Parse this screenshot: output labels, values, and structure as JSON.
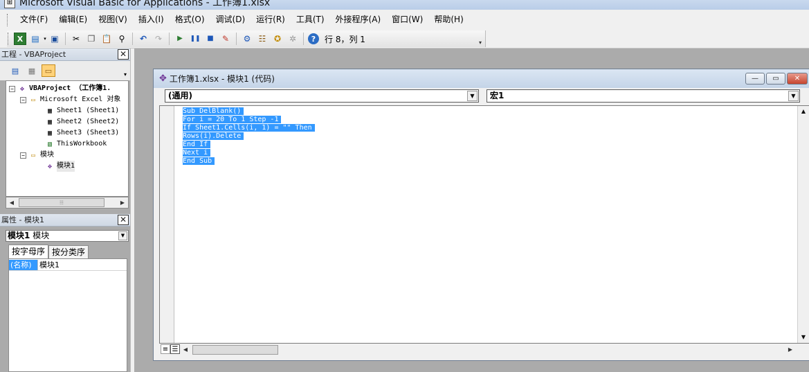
{
  "app": {
    "title": "Microsoft Visual Basic for Applications - 工作簿1.xlsx",
    "icon": "vba-app-icon"
  },
  "menu": [
    "文件(F)",
    "编辑(E)",
    "视图(V)",
    "插入(I)",
    "格式(O)",
    "调试(D)",
    "运行(R)",
    "工具(T)",
    "外接程序(A)",
    "窗口(W)",
    "帮助(H)"
  ],
  "toolbar": {
    "icons": [
      "excel-icon",
      "insert-module-icon",
      "save-icon",
      "cut-icon",
      "copy-icon",
      "paste-icon",
      "find-icon",
      "undo-icon",
      "redo-icon",
      "run-icon",
      "break-icon",
      "reset-icon",
      "design-mode-icon",
      "project-explorer-icon",
      "properties-icon",
      "object-browser-icon",
      "toolbox-icon",
      "help-icon"
    ],
    "position": "行 8，列 1"
  },
  "project": {
    "title": "工程 - VBAProject",
    "tree": [
      {
        "label": "VBAProject （工作簿1.",
        "level": 0,
        "toggle": "−",
        "icon": "vba-project-icon",
        "bold": true
      },
      {
        "label": "Microsoft Excel 对象",
        "level": 1,
        "toggle": "−",
        "icon": "folder-icon"
      },
      {
        "label": "Sheet1 (Sheet1)",
        "level": 2,
        "icon": "worksheet-icon"
      },
      {
        "label": "Sheet2 (Sheet2)",
        "level": 2,
        "icon": "worksheet-icon"
      },
      {
        "label": "Sheet3 (Sheet3)",
        "level": 2,
        "icon": "worksheet-icon"
      },
      {
        "label": "ThisWorkbook",
        "level": 2,
        "icon": "workbook-icon"
      },
      {
        "label": "模块",
        "level": 1,
        "toggle": "−",
        "icon": "folder-icon"
      },
      {
        "label": "模块1",
        "level": 2,
        "icon": "module-icon",
        "selected": true
      }
    ]
  },
  "properties": {
    "title": "属性 - 模块1",
    "object_name": "模块1",
    "object_type": "模块",
    "tabs": [
      "按字母序",
      "按分类序"
    ],
    "rows": [
      {
        "name": "(名称)",
        "value": "模块1"
      }
    ]
  },
  "code_window": {
    "title": "工作簿1.xlsx - 模块1 (代码)",
    "object_combo": "(通用)",
    "proc_combo": "宏1",
    "lines": [
      "Sub DelBlank()",
      "For i = 20 To 1 Step -1",
      "If Sheet1.Cells(i, 1) = \"\" Then",
      "Rows(i).Delete",
      "End If",
      "Next i",
      "End Sub"
    ]
  },
  "colors": {
    "selection": "#3399ff",
    "chrome": "#f0f0f0",
    "workspace": "#ababab"
  }
}
